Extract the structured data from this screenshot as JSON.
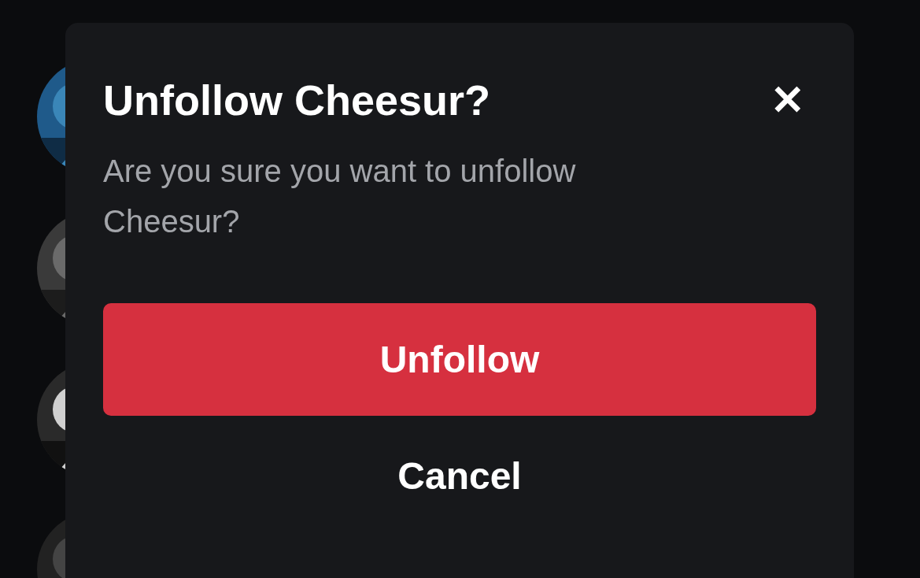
{
  "dialog": {
    "title": "Unfollow Cheesur?",
    "close": "✕",
    "message": "Are you sure you want to unfollow Cheesur?",
    "buttons": [
      {
        "label": "Unfollow",
        "kind": "danger"
      },
      {
        "label": "Cancel",
        "kind": "plain"
      }
    ]
  }
}
